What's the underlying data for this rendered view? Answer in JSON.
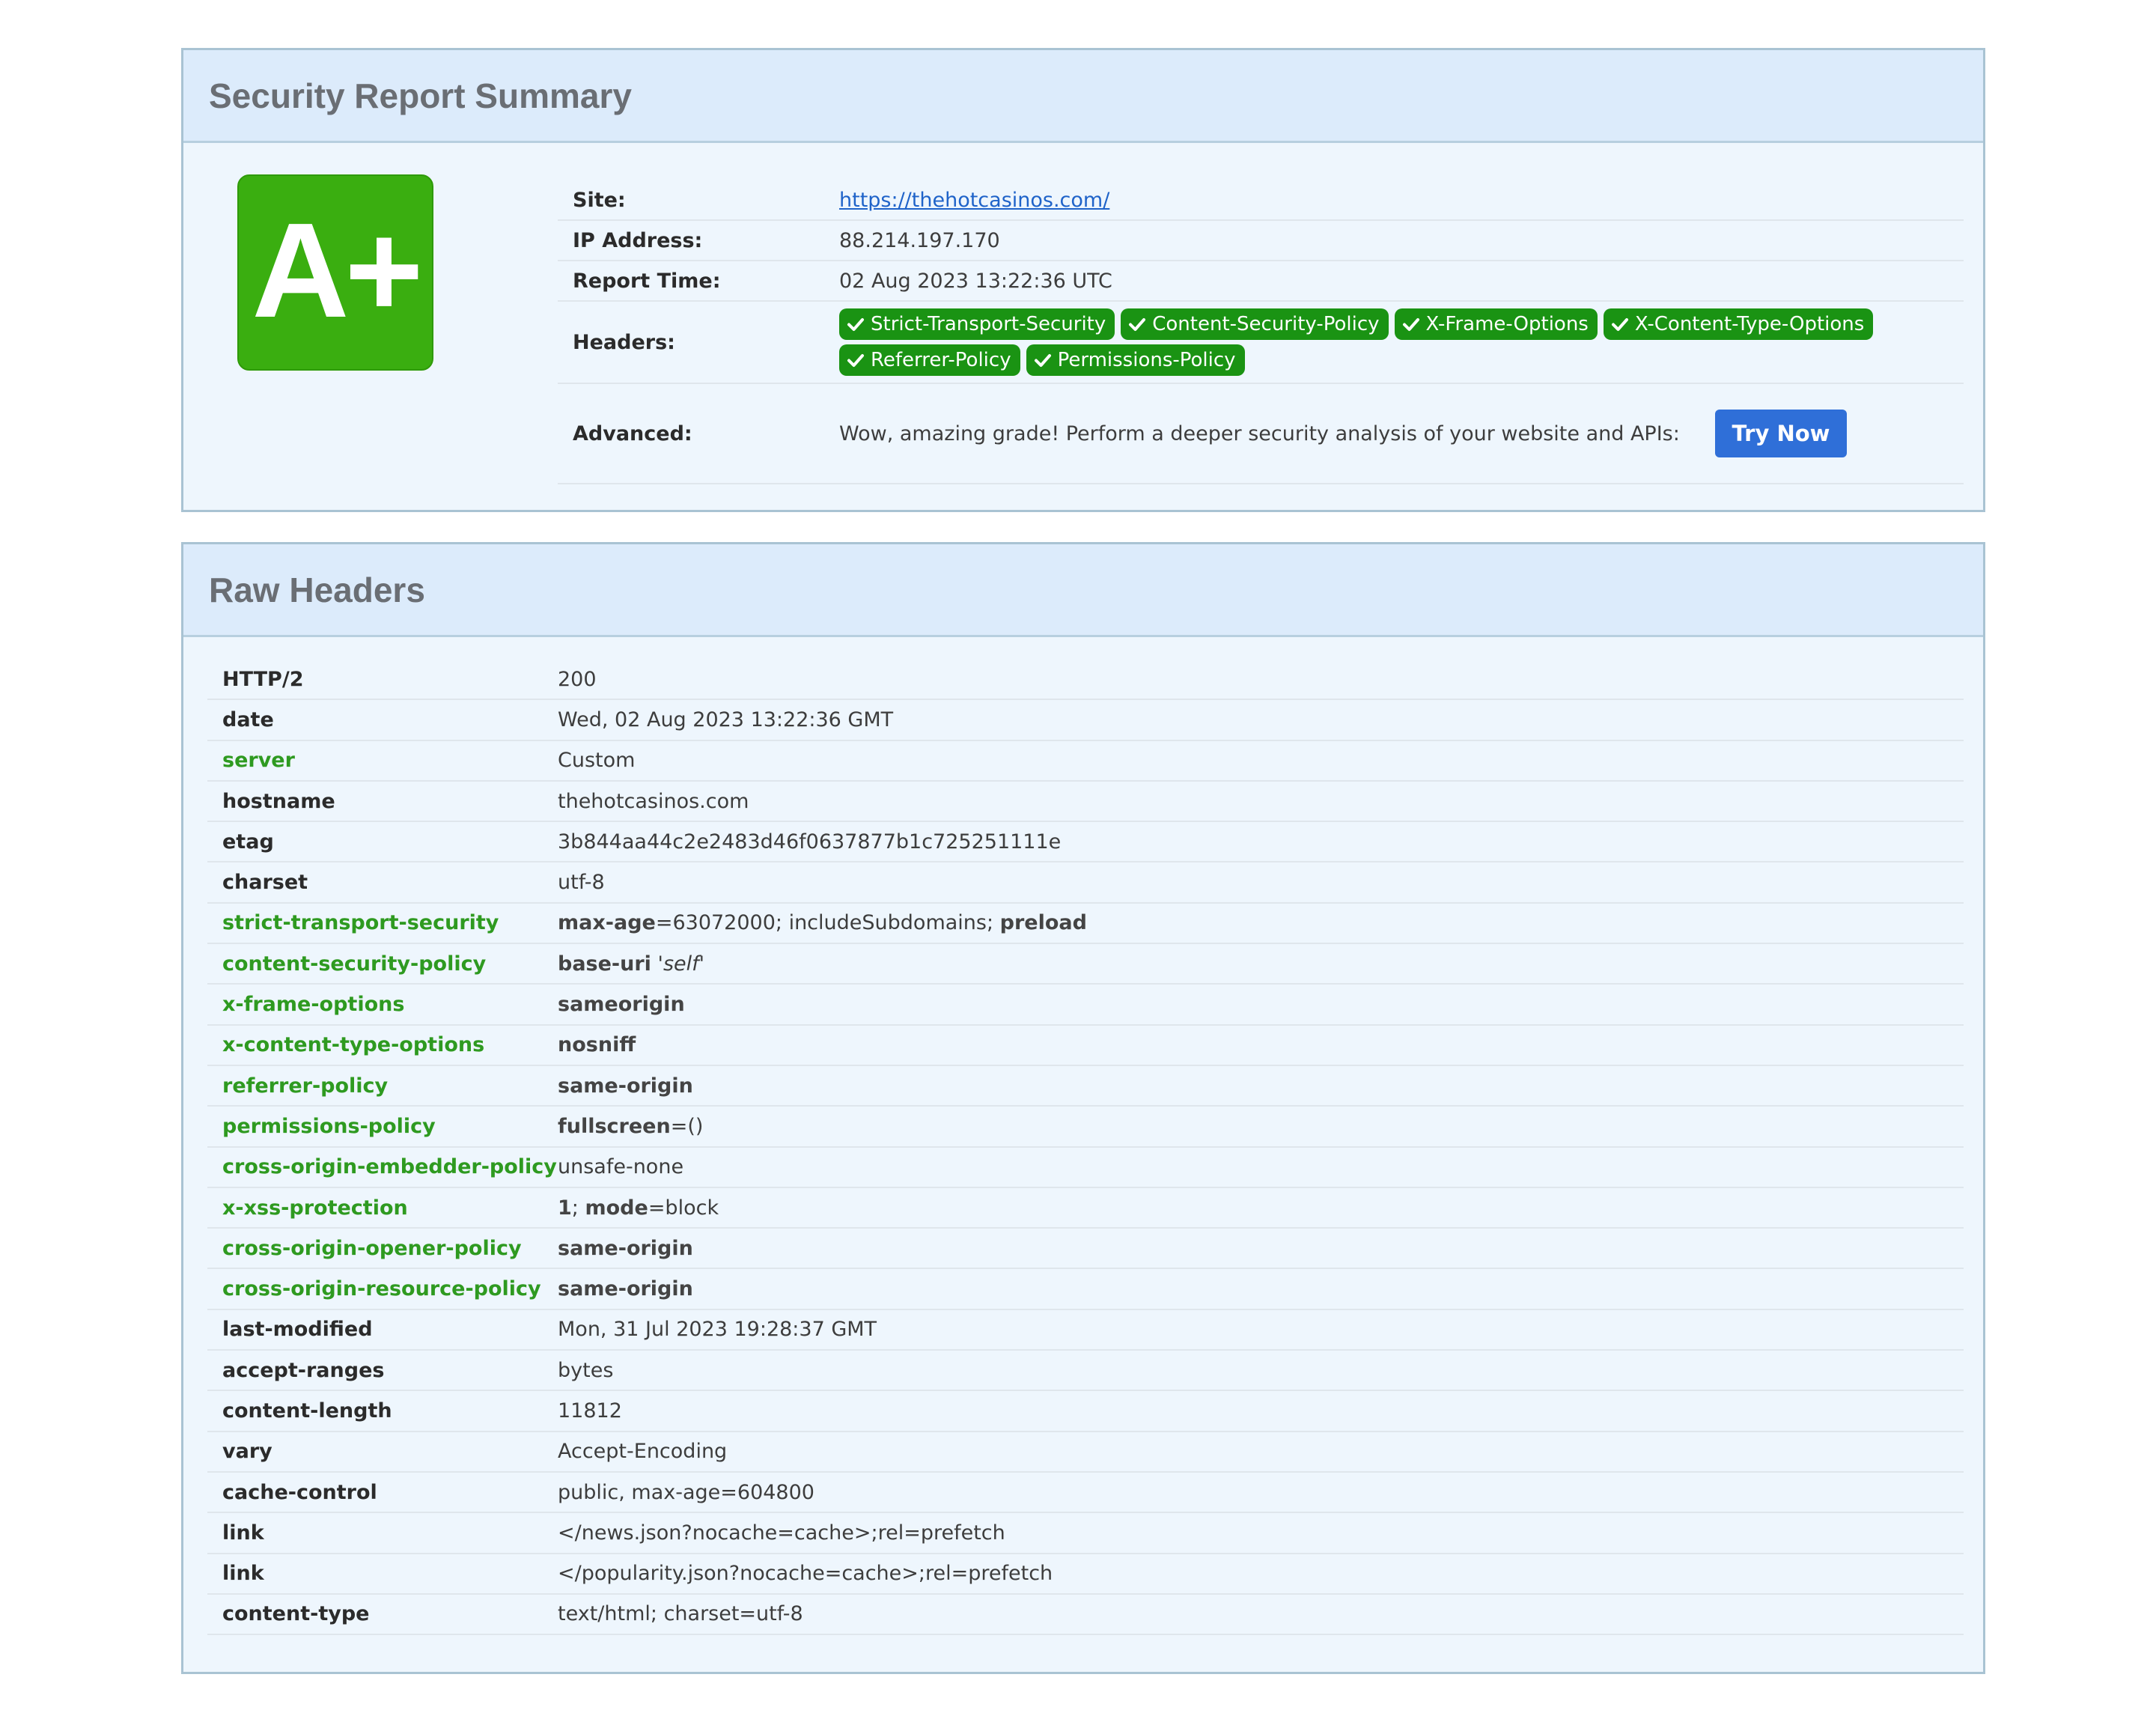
{
  "summary": {
    "title": "Security Report Summary",
    "grade": "A+",
    "grade_color": "#3aae10",
    "site_label": "Site:",
    "site_url": "https://thehotcasinos.com/",
    "ip_label": "IP Address:",
    "ip": "88.214.197.170",
    "time_label": "Report Time:",
    "time": "02 Aug 2023 13:22:36 UTC",
    "headers_label": "Headers:",
    "badges": [
      "Strict-Transport-Security",
      "Content-Security-Policy",
      "X-Frame-Options",
      "X-Content-Type-Options",
      "Referrer-Policy",
      "Permissions-Policy"
    ],
    "badge_icon": "check-icon",
    "advanced_label": "Advanced:",
    "advanced_text": "Wow, amazing grade! Perform a deeper security analysis of your website and APIs:",
    "try_now": "Try Now"
  },
  "raw": {
    "title": "Raw Headers",
    "rows": [
      {
        "key": "HTTP/2",
        "value": "200"
      },
      {
        "key": "date",
        "value": "Wed, 02 Aug 2023 13:22:36 GMT"
      },
      {
        "key": "server",
        "value": "Custom",
        "security": true
      },
      {
        "key": "hostname",
        "value": "thehotcasinos.com"
      },
      {
        "key": "etag",
        "value": "3b844aa44c2e2483d46f0637877b1c725251111e"
      },
      {
        "key": "charset",
        "value": "utf-8"
      },
      {
        "key": "strict-transport-security",
        "security": true,
        "parts": [
          {
            "t": "max-age",
            "b": true
          },
          {
            "t": "=63072000; includeSubdomains; "
          },
          {
            "t": "preload",
            "b": true
          }
        ]
      },
      {
        "key": "content-security-policy",
        "security": true,
        "parts": [
          {
            "t": "base-uri",
            "b": true
          },
          {
            "t": " "
          },
          {
            "t": "'self'",
            "i": true
          }
        ]
      },
      {
        "key": "x-frame-options",
        "security": true,
        "parts": [
          {
            "t": "sameorigin",
            "b": true
          }
        ]
      },
      {
        "key": "x-content-type-options",
        "security": true,
        "parts": [
          {
            "t": "nosniff",
            "b": true
          }
        ]
      },
      {
        "key": "referrer-policy",
        "security": true,
        "parts": [
          {
            "t": "same-origin",
            "b": true
          }
        ]
      },
      {
        "key": "permissions-policy",
        "security": true,
        "parts": [
          {
            "t": "fullscreen",
            "b": true
          },
          {
            "t": "=()"
          }
        ]
      },
      {
        "key": "cross-origin-embedder-policy",
        "value": "unsafe-none",
        "security": true
      },
      {
        "key": "x-xss-protection",
        "security": true,
        "parts": [
          {
            "t": "1",
            "b": true
          },
          {
            "t": "; "
          },
          {
            "t": "mode",
            "b": true
          },
          {
            "t": "=block"
          }
        ]
      },
      {
        "key": "cross-origin-opener-policy",
        "security": true,
        "parts": [
          {
            "t": "same-origin",
            "b": true
          }
        ]
      },
      {
        "key": "cross-origin-resource-policy",
        "security": true,
        "parts": [
          {
            "t": "same-origin",
            "b": true
          }
        ]
      },
      {
        "key": "last-modified",
        "value": "Mon, 31 Jul 2023 19:28:37 GMT"
      },
      {
        "key": "accept-ranges",
        "value": "bytes"
      },
      {
        "key": "content-length",
        "value": "11812"
      },
      {
        "key": "vary",
        "value": "Accept-Encoding"
      },
      {
        "key": "cache-control",
        "value": "public, max-age=604800"
      },
      {
        "key": "link",
        "value": "</news.json?nocache=cache>;rel=prefetch"
      },
      {
        "key": "link",
        "value": "</popularity.json?nocache=cache>;rel=prefetch"
      },
      {
        "key": "content-type",
        "value": "text/html; charset=utf-8"
      }
    ]
  }
}
